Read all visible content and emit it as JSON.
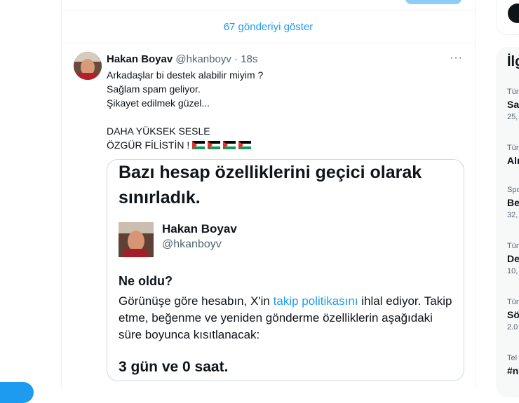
{
  "show_more": "67 gönderiyi göster",
  "tweet": {
    "name": "Hakan Boyav",
    "handle": "@hkanboyv",
    "time": "18s",
    "more": "···",
    "lines": [
      "Arkadaşlar bi destek alabilir miyim ?",
      "Sağlam spam geliyor.",
      "Şikayet edilmek güzel...",
      "",
      "DAHA YÜKSEK SESLE",
      "ÖZGÜR FİLİSTİN !"
    ],
    "flag_icons": [
      "palestine-flag",
      "palestine-flag",
      "palestine-flag",
      "palestine-flag"
    ]
  },
  "media": {
    "title": "Bazı hesap özelliklerini geçici olarak sınırladık.",
    "name": "Hakan Boyav",
    "handle": "@hkanboyv",
    "what_heading": "Ne oldu?",
    "body_before_link": "Görünüşe göre hesabın, X'in ",
    "body_link": "takip politikasını",
    "body_after_link": " ihlal ediyor. Takip etme, beğenme ve yeniden gönderme özelliklerin aşağıdaki süre boyunca kısıtlanacak:",
    "duration": "3 gün ve 0 saat."
  },
  "right": {
    "heading": "İlg",
    "trends": [
      {
        "cat": "Tür",
        "title": "Sa",
        "count": "25,"
      },
      {
        "cat": "Tür",
        "title": "Alı",
        "count": ""
      },
      {
        "cat": "Spo",
        "title": "Be",
        "count": "32,"
      },
      {
        "cat": "Tür",
        "title": "De",
        "count": "10,"
      },
      {
        "cat": "Tür",
        "title": "Sö",
        "count": "2.0"
      },
      {
        "cat": "Tel",
        "title": "#n",
        "count": ""
      }
    ]
  },
  "colors": {
    "accent": "#1d9bf0",
    "text": "#0f1419",
    "muted": "#536471",
    "border": "#eff3f4"
  }
}
